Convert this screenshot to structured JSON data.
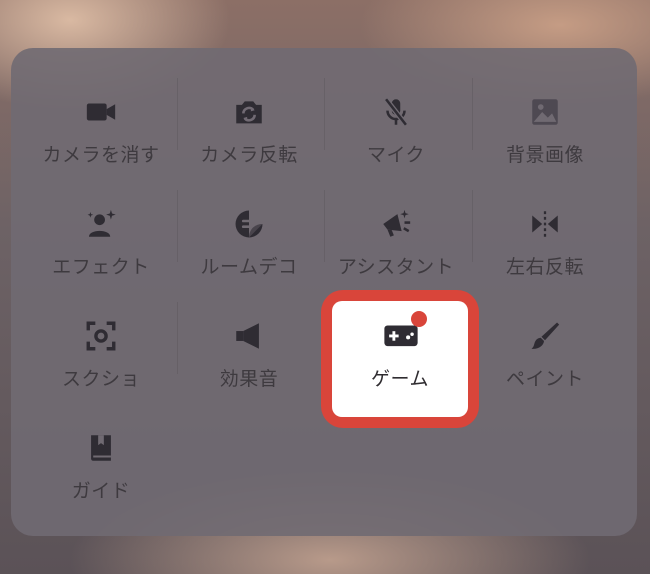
{
  "menu": {
    "items": [
      {
        "label": "カメラを消す",
        "icon": "video-camera-icon"
      },
      {
        "label": "カメラ反転",
        "icon": "camera-flip-icon"
      },
      {
        "label": "マイク",
        "icon": "mic-off-icon"
      },
      {
        "label": "背景画像",
        "icon": "image-icon"
      },
      {
        "label": "エフェクト",
        "icon": "person-sparkle-icon"
      },
      {
        "label": "ルームデコ",
        "icon": "sticker-icon"
      },
      {
        "label": "アシスタント",
        "icon": "megaphone-sparkle-icon"
      },
      {
        "label": "左右反転",
        "icon": "mirror-flip-icon"
      },
      {
        "label": "スクショ",
        "icon": "screenshot-icon"
      },
      {
        "label": "効果音",
        "icon": "speaker-icon"
      },
      {
        "label": "ゲーム",
        "icon": "gamepad-icon"
      },
      {
        "label": "ペイント",
        "icon": "brush-icon"
      },
      {
        "label": "ガイド",
        "icon": "book-icon"
      }
    ],
    "highlighted_label": "ゲーム",
    "colors": {
      "highlight": "#d9453a",
      "icon": "#2f2c33",
      "panel": "#706a72"
    }
  }
}
